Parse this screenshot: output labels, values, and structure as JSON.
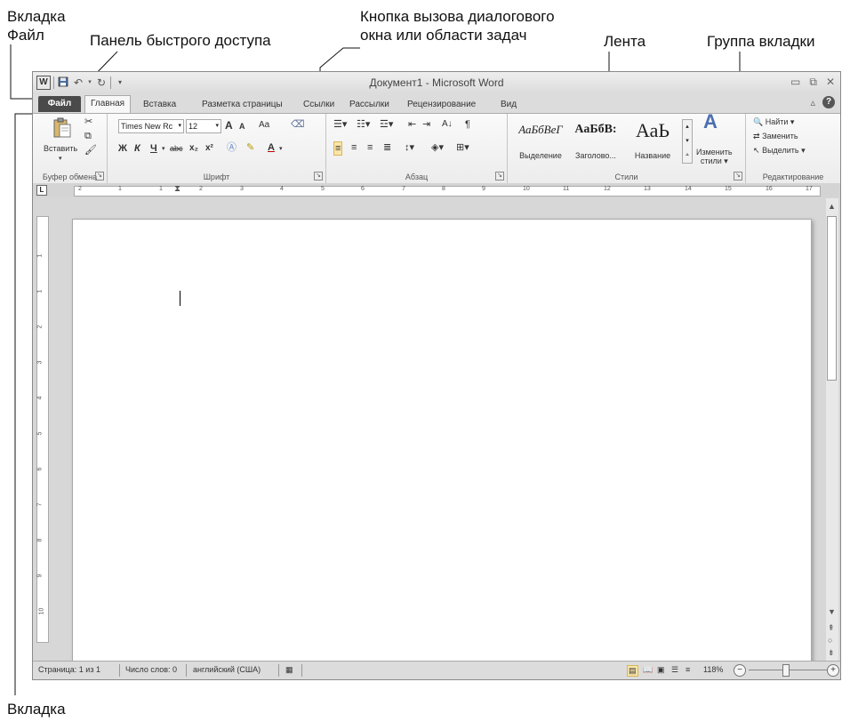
{
  "callouts": {
    "file_tab_line1": "Вкладка",
    "file_tab_line2": "Файл",
    "qat": "Панель быстрого доступа",
    "launcher_line1": "Кнопка вызова диалогового",
    "launcher_line2": "окна или области задач",
    "ribbon": "Лента",
    "group": "Группа вкладки",
    "bottom_tab": "Вкладка"
  },
  "window": {
    "title": "Документ1 - Microsoft Word",
    "word_icon": "W",
    "icons": {
      "save": "save-icon",
      "undo": "undo-icon",
      "redo": "redo-icon",
      "customize": "qat-customize-icon"
    }
  },
  "tabs": [
    "Файл",
    "Главная",
    "Вставка",
    "Разметка страницы",
    "Ссылки",
    "Рассылки",
    "Рецензирование",
    "Вид"
  ],
  "active_tab": "Главная",
  "ribbon": {
    "clipboard": {
      "paste_label": "Вставить",
      "group_label": "Буфер обмена"
    },
    "font": {
      "font_name": "Times New Rc",
      "font_size": "12",
      "grow": "A",
      "shrink": "A",
      "change_case": "Aa",
      "bold": "Ж",
      "italic": "К",
      "underline": "Ч",
      "strike": "abc",
      "subscript": "x₂",
      "superscript": "x²",
      "group_label": "Шрифт"
    },
    "paragraph": {
      "group_label": "Абзац",
      "sort": "А↓",
      "pilcrow": "¶"
    },
    "styles": {
      "items": [
        {
          "sample": "АаБбВеГ",
          "name": "Выделение"
        },
        {
          "sample": "АаБбВ:",
          "name": "Заголово..."
        },
        {
          "sample": "АаЬ",
          "name": "Название"
        }
      ],
      "change_styles_line1": "Изменить",
      "change_styles_line2": "стили ▾",
      "group_label": "Стили"
    },
    "editing": {
      "find": "Найти ▾",
      "replace": "Заменить",
      "select": "Выделить ▾",
      "group_label": "Редактирование"
    }
  },
  "ruler": {
    "corner": "L",
    "h_numbers": [
      "2",
      "1",
      "1",
      "2",
      "3",
      "4",
      "5",
      "6",
      "7",
      "8",
      "9",
      "10",
      "11",
      "12",
      "13",
      "14",
      "15",
      "16",
      "17"
    ],
    "v_numbers": [
      "1",
      "1",
      "2",
      "3",
      "4",
      "5",
      "6",
      "7",
      "8",
      "9",
      "10"
    ]
  },
  "status": {
    "page": "Страница: 1 из 1",
    "words": "Число слов: 0",
    "language": "английский (США)",
    "zoom": "118%",
    "zoom_minus": "−",
    "zoom_plus": "+"
  }
}
